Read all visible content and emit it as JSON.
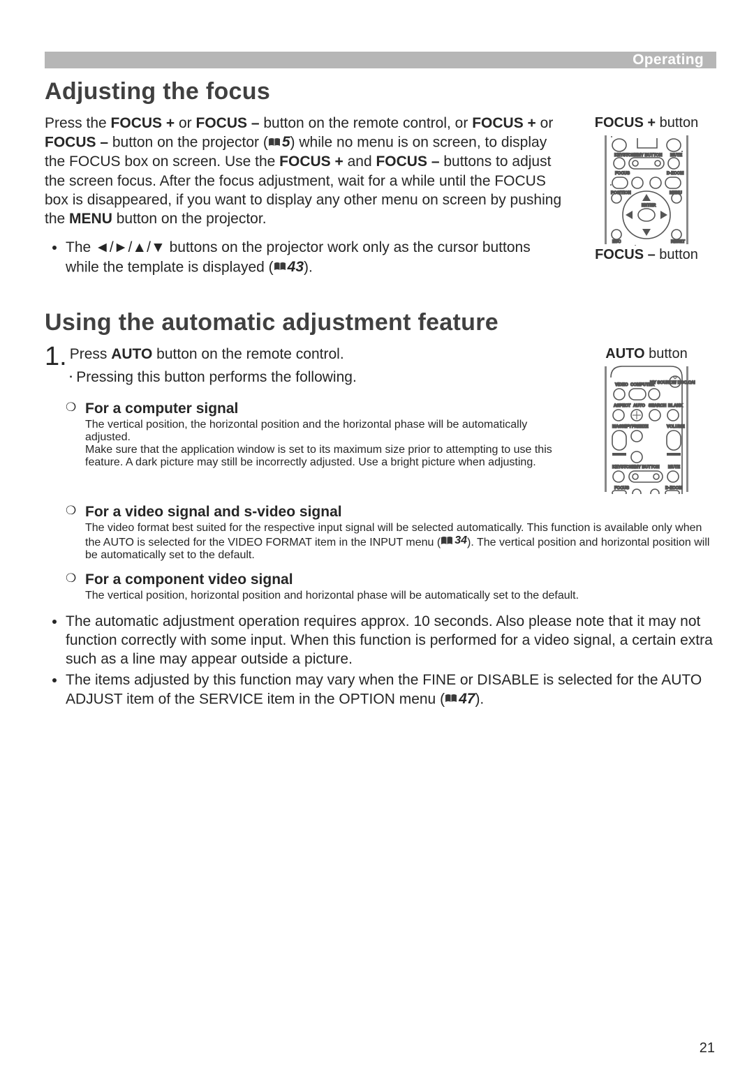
{
  "header": {
    "section": "Operating"
  },
  "page_number": "21",
  "focus": {
    "title": "Adjusting the focus",
    "body": [
      "Press the ",
      {
        "b": "FOCUS +"
      },
      " or ",
      {
        "b": "FOCUS –"
      },
      " button on the remote control, or ",
      {
        "b": "FOCUS +"
      },
      " or ",
      {
        "b": "FOCUS –"
      },
      " button on the projector (",
      {
        "ref": "5"
      },
      ") while no menu is on screen, to display the FOCUS box on screen.  Use the ",
      {
        "b": "FOCUS +"
      },
      " and ",
      {
        "b": "FOCUS –"
      },
      " buttons to adjust the screen focus.  After the focus adjustment, wait for a while until the FOCUS box is disappeared, if you want to display any other menu on screen by pushing the ",
      {
        "b": "MENU"
      },
      " button on the projector."
    ],
    "bullet": [
      "The ",
      {
        "arrow": "◄"
      },
      "/",
      {
        "arrow": "►"
      },
      "/",
      {
        "arrow": "▲"
      },
      "/",
      {
        "arrow": "▼"
      },
      " buttons on the projector work only as the cursor buttons while the template is displayed (",
      {
        "ref": "43"
      },
      ")."
    ],
    "side": {
      "top_caption": [
        {
          "b": "FOCUS +"
        },
        " button"
      ],
      "bottom_caption": [
        {
          "b": "FOCUS –"
        },
        " button"
      ]
    }
  },
  "auto": {
    "title": "Using the automatic adjustment feature",
    "step1_line1": [
      "Press ",
      {
        "b": "AUTO"
      },
      " button on the remote control."
    ],
    "step1_line2": "Pressing this button performs the following.",
    "side_caption": [
      {
        "b": "AUTO"
      },
      " button"
    ],
    "items": [
      {
        "heading": "For a computer signal",
        "body": "The vertical position, the horizontal position and the horizontal phase will be automatically adjusted.\nMake sure that the application window is set to its maximum size prior to attempting to use this feature. A dark picture may still be incorrectly adjusted. Use a bright picture when adjusting."
      },
      {
        "heading": "For a video signal and s-video signal",
        "body_rich": [
          "The video format best suited for the respective input signal will be selected automatically. This function is available only when the AUTO is selected for the VIDEO FORMAT item in the INPUT menu (",
          {
            "ref": "34"
          },
          "). The vertical position and horizontal position will be automatically set to the default."
        ]
      },
      {
        "heading": "For a component video signal",
        "body": "The vertical position, horizontal position and horizontal phase will be automatically set to the default."
      }
    ],
    "notes": [
      "The automatic adjustment operation requires approx. 10 seconds. Also please note that it may not function correctly with some input. When this function is performed for a video signal, a certain extra such as a line may appear outside a picture.",
      [
        "The items adjusted by this function may vary when the FINE or DISABLE is selected for the AUTO ADJUST item of the SERVICE item in the OPTION menu (",
        {
          "ref": "47"
        },
        ")."
      ]
    ]
  },
  "remote_labels": {
    "keystone": "KEYSTONE",
    "mybutton": "MY BUTTON",
    "mute": "MUTE",
    "focus": "FOCUS",
    "dzoom": "D-ZOOM",
    "position": "POSITION",
    "menu": "MENU",
    "enter": "ENTER",
    "esc": "ESC",
    "reset": "RESET",
    "video": "VIDEO",
    "computer": "COMPUTER",
    "mysource": "MY SOURCE/\nDOC.CAMERA",
    "aspect": "ASPECT",
    "auto": "AUTO",
    "search": "SEARCH",
    "blank": "BLANK",
    "magnify": "MAGNIFY",
    "freeze": "FREEZE",
    "pageup": "PAGE\nUP",
    "volume": "VOLUME"
  }
}
